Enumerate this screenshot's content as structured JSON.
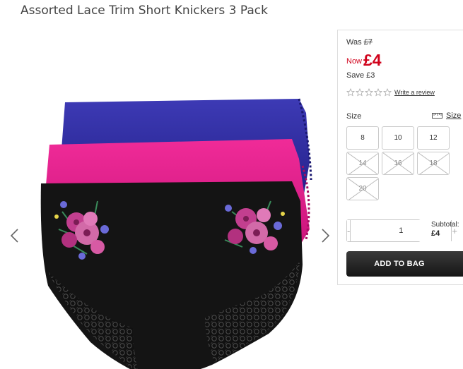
{
  "product": {
    "title": "Assorted Lace Trim Short Knickers 3 Pack"
  },
  "price": {
    "was_label": "Was",
    "was_value": "£7",
    "now_label": "Now",
    "now_value": "£4",
    "save_label": "Save",
    "save_value": "£3"
  },
  "rating": {
    "stars": 0,
    "max": 5,
    "review_link": "Write a review"
  },
  "sizes": {
    "label": "Size",
    "guide_label": "Size",
    "options": [
      {
        "label": "8",
        "available": true
      },
      {
        "label": "10",
        "available": true
      },
      {
        "label": "12",
        "available": true
      },
      {
        "label": "14",
        "available": false
      },
      {
        "label": "16",
        "available": false
      },
      {
        "label": "18",
        "available": false
      },
      {
        "label": "20",
        "available": false
      }
    ]
  },
  "quantity": {
    "minus": "-",
    "value": "1",
    "plus": "+"
  },
  "subtotal": {
    "label": "Subtotal:",
    "value": "£4"
  },
  "add_to_bag": "ADD TO BAG",
  "colors": {
    "price_red": "#d0021b",
    "navy": "#2e2b9a",
    "pink": "#e0218a",
    "black": "#111111"
  },
  "icons": {
    "prev": "chevron-left-icon",
    "next": "chevron-right-icon",
    "star": "star-outline-icon",
    "ruler": "ruler-icon"
  }
}
